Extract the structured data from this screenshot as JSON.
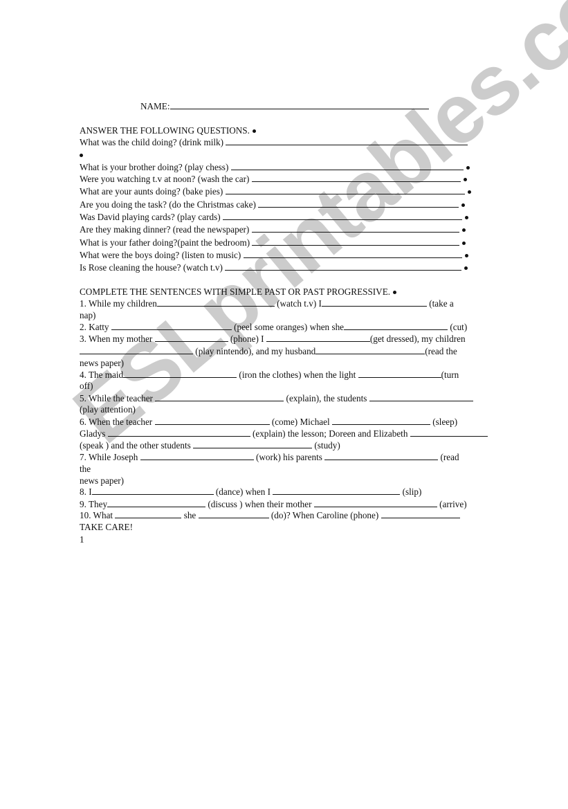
{
  "name_label": "NAME:",
  "section1": {
    "heading": "ANSWER THE FOLLOWING QUESTIONS.",
    "questions": [
      "What was the child doing? (drink milk)",
      "What is your brother doing? (play chess)",
      "Were you watching t.v at noon? (wash the car)",
      "What are your aunts doing? (bake pies)",
      "Are you doing the task? (do the Christmas cake)",
      "Was David playing cards? (play cards)",
      "Are they making dinner? (read the newspaper)",
      "What is your father doing?(paint the bedroom)",
      "What were the boys doing? (listen to music)",
      "Is Rose cleaning the house? (watch t.v)"
    ]
  },
  "section2": {
    "heading": "COMPLETE THE SENTENCES WITH SIMPLE PAST OR PAST PROGRESSIVE.",
    "t": {
      "s1a": "1. While my children",
      "s1b": "(watch t.v) I",
      "s1c": "(take a",
      "s1d": "nap)",
      "s2a": "2. Katty",
      "s2b": "(peel some oranges) when she",
      "s2c": "(cut)",
      "s3a": "3. When my mother",
      "s3b": "(phone) I",
      "s3c": "(get dressed), my children",
      "s3d": "(play nintendo), and my husband",
      "s3e": "(read the",
      "s3f": "news paper)",
      "s4a": "4. The maid",
      "s4b": "(iron the clothes) when the light",
      "s4c": "(turn",
      "s4d": "off)",
      "s5a": "5. While the teacher",
      "s5b": "(explain), the students",
      "s5c": "(play attention)",
      "s6a": "6. When the teacher",
      "s6b": "(come) Michael",
      "s6c": "(sleep)",
      "s6d": "Gladys",
      "s6e": "(explain) the lesson; Doreen and Elizabeth",
      "s6f": "(speak ) and the other students",
      "s6g": "(study)",
      "s7a": "7. While Joseph",
      "s7b": "(work) his parents",
      "s7c": "(read",
      "s7d": "the",
      "s7e": "news paper)",
      "s8a": "8. I",
      "s8b": "(dance) when I",
      "s8c": "(slip)",
      "s9a": "9. They",
      "s9b": "(discuss ) when their mother",
      "s9c": "(arrive)",
      "s10a": "10. What",
      "s10b": "she",
      "s10c": "(do)? When Caroline (phone)"
    }
  },
  "closing": "TAKE CARE!",
  "page_number": "1",
  "watermark": "ESLprintables.com"
}
